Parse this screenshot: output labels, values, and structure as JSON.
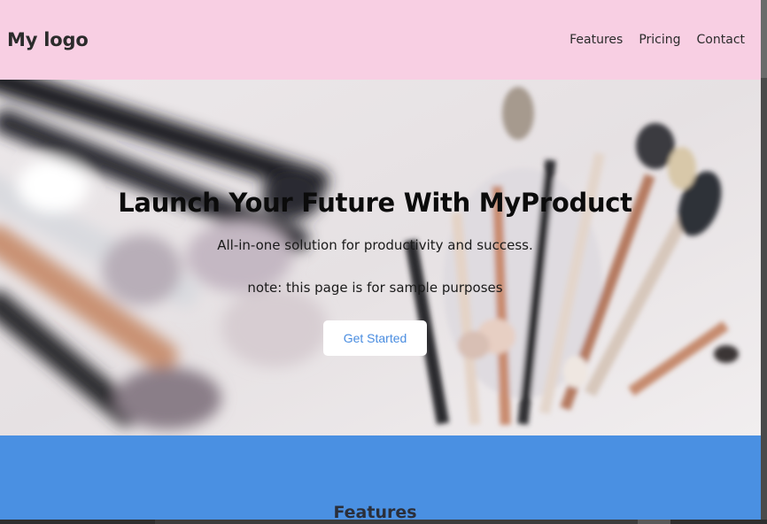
{
  "header": {
    "logo": "My logo",
    "nav": [
      "Features",
      "Pricing",
      "Contact"
    ],
    "background": "#f8cfe3"
  },
  "hero": {
    "title": "Launch Your Future With MyProduct",
    "subtitle": "All-in-one solution for productivity and success.",
    "note": "note: this page is for sample purposes",
    "cta_label": "Get Started",
    "cta_color": "#4a8de0",
    "image": "makeup-brushes-photo"
  },
  "features": {
    "title": "Features",
    "background": "#4a90e2"
  }
}
